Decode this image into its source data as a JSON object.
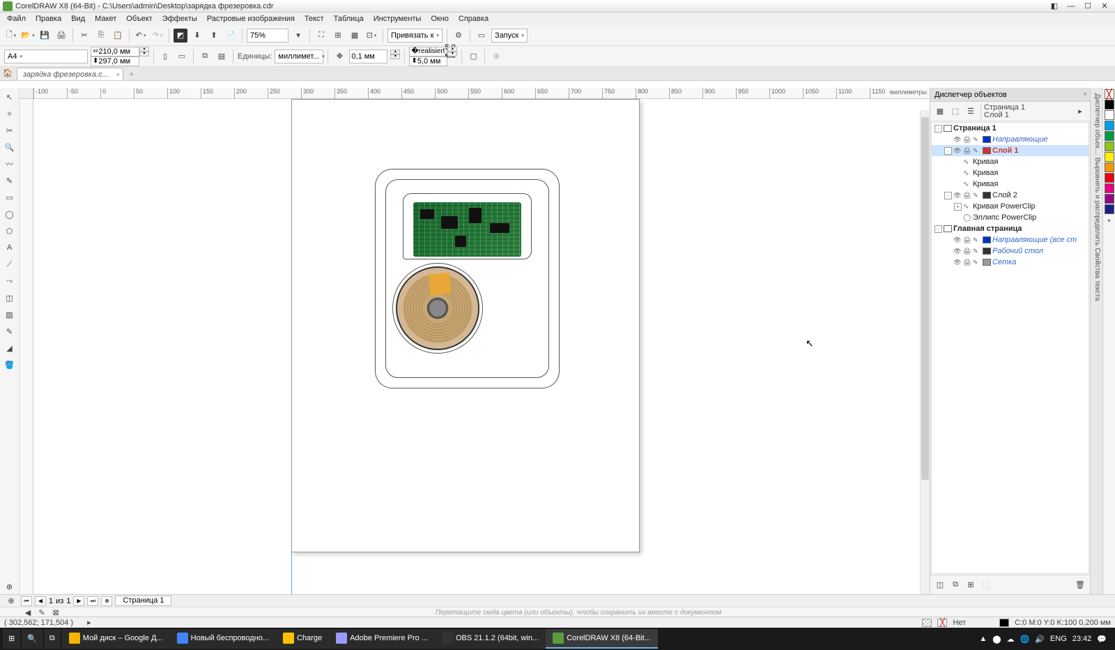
{
  "title": "CorelDRAW X8 (64-Bit) - C:\\Users\\admin\\Desktop\\зарядка фрезеровка.cdr",
  "menu": [
    "Файл",
    "Правка",
    "Вид",
    "Макет",
    "Объект",
    "Эффекты",
    "Растровые изображения",
    "Текст",
    "Таблица",
    "Инструменты",
    "Окно",
    "Справка"
  ],
  "zoom": "75%",
  "snap_label": "Привязать к",
  "launch_label": "Запуск",
  "paper_size": "A4",
  "page_w": "210,0 мм",
  "page_h": "297,0 мм",
  "units_label": "Единицы:",
  "units_value": "миллимет...",
  "nudge": "0,1 мм",
  "dup_x": "5,0 мм",
  "dup_y": "5,0 мм",
  "doc_tab": "зарядка фрезеровка.c...",
  "ruler_unit": "миллиметры",
  "ruler_h": [
    "-100",
    "-50",
    "0",
    "50",
    "100",
    "150",
    "200",
    "250",
    "300",
    "350",
    "400",
    "450",
    "500",
    "550",
    "600",
    "650",
    "700",
    "750",
    "800",
    "850",
    "900",
    "950",
    "1000",
    "1050",
    "1100",
    "1150"
  ],
  "panel": {
    "title": "Диспетчер объектов",
    "info_line1": "Страница 1",
    "info_line2": "Слой 1",
    "tree": [
      {
        "indent": 0,
        "exp": "-",
        "label": "Страница 1",
        "bold": true,
        "sw": "#fff"
      },
      {
        "indent": 1,
        "exp": "",
        "label": "Направляющие",
        "ital": true,
        "sw": "#0033cc",
        "eyes": true
      },
      {
        "indent": 1,
        "exp": "-",
        "label": "Слой 1",
        "red": true,
        "sw": "#cc3333",
        "eyes": true,
        "sel": true
      },
      {
        "indent": 2,
        "label": "Кривая",
        "icon": "curve"
      },
      {
        "indent": 2,
        "label": "Кривая",
        "icon": "curve"
      },
      {
        "indent": 2,
        "label": "Кривая",
        "icon": "curve"
      },
      {
        "indent": 1,
        "exp": "-",
        "label": "Слой 2",
        "sw": "#333",
        "eyes": true
      },
      {
        "indent": 2,
        "exp": "+",
        "label": "Кривая PowerClip",
        "icon": "curve"
      },
      {
        "indent": 2,
        "exp": "",
        "label": "Эллипс PowerClip",
        "icon": "ellipse"
      },
      {
        "indent": 0,
        "exp": "-",
        "label": "Главная страница",
        "bold": true,
        "sw": "#fff"
      },
      {
        "indent": 1,
        "label": "Направляющие (все ст",
        "ital": true,
        "sw": "#0033cc",
        "eyes": true
      },
      {
        "indent": 1,
        "label": "Рабочий стол",
        "ital": true,
        "sw": "#333",
        "eyes": true
      },
      {
        "indent": 1,
        "label": "Сетка",
        "ital": true,
        "sw": "#999",
        "eyes": true
      }
    ]
  },
  "colors": [
    "#000",
    "#fff",
    "#00a0e9",
    "#009944",
    "#8fc31f",
    "#fff100",
    "#f39800",
    "#e60012",
    "#e4007f",
    "#920783",
    "#1d2088"
  ],
  "nav": {
    "page_cur": "1",
    "of": "из",
    "page_total": "1",
    "page_tab": "Страница 1"
  },
  "tray_hint": "Перетащите сюда цвета (или объекты), чтобы сохранить их вместе с документом",
  "status": {
    "coords": "( 302,562; 171,504 )",
    "fill_label": "Нет",
    "cmyk": "C:0 M:0 Y:0 K:100  0,200 мм"
  },
  "taskbar": {
    "items": [
      {
        "label": "Мой диск – Google Д...",
        "color": "#f4b400"
      },
      {
        "label": "Новый беспроводно...",
        "color": "#4285f4"
      },
      {
        "label": "Charge",
        "color": "#ffc107"
      },
      {
        "label": "Adobe Premiere Pro ...",
        "color": "#9a9aff"
      },
      {
        "label": "OBS 21.1.2 (64bit, win...",
        "color": "#333"
      },
      {
        "label": "CorelDRAW X8 (64-Bit...",
        "color": "#5a9c3e",
        "active": true
      }
    ],
    "lang": "ENG",
    "time": "23:42",
    "date": ""
  }
}
